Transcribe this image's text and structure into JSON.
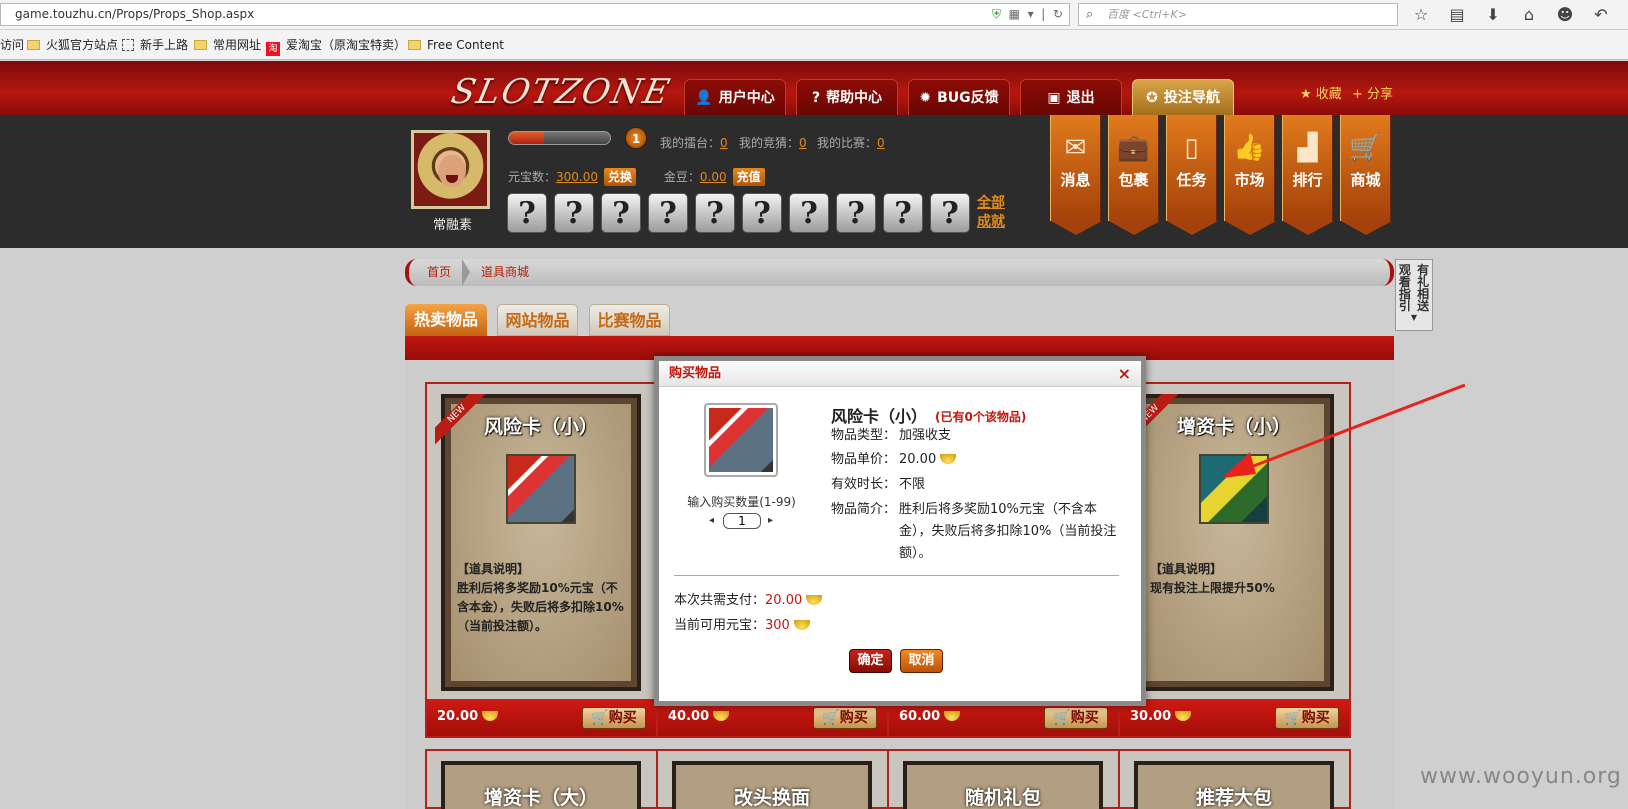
{
  "browser": {
    "url": "game.touzhu.cn/Props/Props_Shop.aspx",
    "search_placeholder": "百度 <Ctrl+K>",
    "bookmarks": [
      "访问",
      "火狐官方站点",
      "新手上路",
      "常用网址",
      "爱淘宝（原淘宝特卖）",
      "Free Content"
    ]
  },
  "site": {
    "logo": "SLOTZONE",
    "nav": [
      "用户中心",
      "帮助中心",
      "BUG反馈",
      "退出",
      "投注导航"
    ],
    "fav": "收藏",
    "share": "分享"
  },
  "user": {
    "name": "常融素",
    "level": "1",
    "progress": 0.35,
    "arena_label": "我的擂台：",
    "arena": "0",
    "guess_label": "我的竞猜：",
    "guess": "0",
    "match_label": "我的比赛：",
    "match": "0",
    "yuanbao_label": "元宝数：",
    "yuanbao": "300.00",
    "exchange": "兑换",
    "jindou_label": "金豆：",
    "jindou": "0.00",
    "recharge": "充值",
    "all_ach_1": "全部",
    "all_ach_2": "成就",
    "medal_glyph": "?"
  },
  "sidetabs": [
    "消息",
    "包裹",
    "任务",
    "市场",
    "排行",
    "商城"
  ],
  "breadcrumb": {
    "home": "首页",
    "current": "道具商城"
  },
  "right_note": {
    "col1": "观看指引",
    "col2": "有礼相送"
  },
  "tabs": [
    "热卖物品",
    "网站物品",
    "比赛物品"
  ],
  "cards": [
    {
      "title": "风险卡（小）",
      "new": "NEW",
      "desc_head": "【道具说明】",
      "desc": "胜利后将多奖励10%元宝（不含本金），失败后将多扣除10%（当前投注额）。",
      "price": "20.00",
      "buy": "购买"
    },
    {
      "title": "",
      "new": "",
      "desc_head": "",
      "desc": "",
      "price": "40.00",
      "buy": "购买"
    },
    {
      "title": "",
      "new": "",
      "desc_head": "",
      "desc": "",
      "price": "60.00",
      "buy": "购买"
    },
    {
      "title": "增资卡（小）",
      "new": "NEW",
      "desc_head": "【道具说明】",
      "desc": "现有投注上限提升50%",
      "price": "30.00",
      "buy": "购买"
    }
  ],
  "cards_row2": [
    "增资卡（大）",
    "改头换面",
    "随机礼包",
    "推荐大包"
  ],
  "modal": {
    "title": "购买物品",
    "close": "×",
    "qty_label": "输入购买数量(1-99)",
    "qty": "1",
    "name": "风险卡（小）",
    "owned": "(已有0个该物品)",
    "type_k": "物品类型：",
    "type_v": "加强收支",
    "price_k": "物品单价：",
    "price_v": "20.00",
    "duration_k": "有效时长：",
    "duration_v": "不限",
    "intro_k": "物品简介：",
    "intro_v": "胜利后将多奖励10%元宝（不含本金），失败后将多扣除10%（当前投注额）。",
    "total_k": "本次共需支付：",
    "total_v": "20.00",
    "avail_k": "当前可用元宝：",
    "avail_v": "300",
    "confirm": "确定",
    "cancel": "取消"
  },
  "watermark": "www.wooyun.org"
}
